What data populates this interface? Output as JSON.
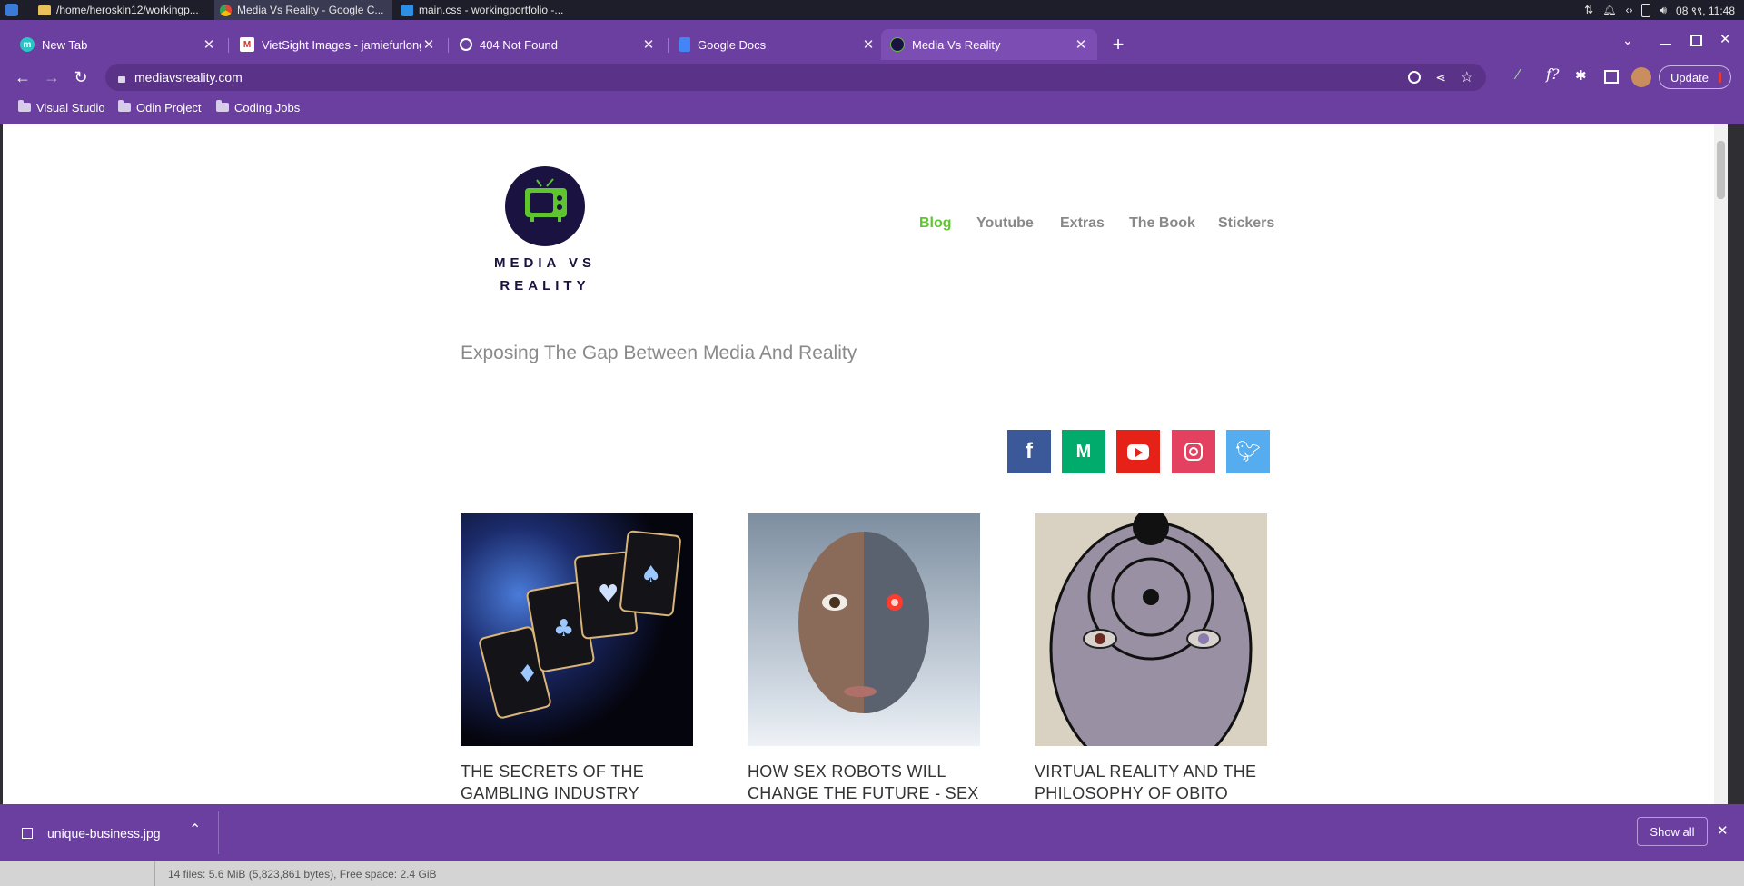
{
  "taskbar": {
    "apps": [
      {
        "label": "/home/heroskin12/workingp..."
      },
      {
        "label": "Media Vs Reality - Google C..."
      },
      {
        "label": "main.css - workingportfolio -..."
      }
    ],
    "clock": "08 ९९, 11:48"
  },
  "browser": {
    "tabs": [
      {
        "title": "New Tab",
        "favicon": "m"
      },
      {
        "title": "VietSight Images - jamiefurlong",
        "favicon": "M"
      },
      {
        "title": "404 Not Found",
        "favicon": "globe"
      },
      {
        "title": "Google Docs",
        "favicon": "docs"
      },
      {
        "title": "Media Vs Reality",
        "favicon": "tv"
      }
    ],
    "url": "mediavsreality.com",
    "update_label": "Update",
    "bookmarks": [
      {
        "label": "Visual Studio"
      },
      {
        "label": "Odin Project"
      },
      {
        "label": "Coding Jobs"
      }
    ]
  },
  "site": {
    "logo_line1": "MEDIA VS",
    "logo_line2": "REALITY",
    "nav": [
      {
        "label": "Blog",
        "active": true
      },
      {
        "label": "Youtube"
      },
      {
        "label": "Extras"
      },
      {
        "label": "The Book"
      },
      {
        "label": "Stickers"
      }
    ],
    "tagline": "Exposing The Gap Between Media And Reality",
    "social": [
      {
        "icon": "facebook-icon",
        "color": "#3b5998"
      },
      {
        "icon": "medium-icon",
        "color": "#00ab6c"
      },
      {
        "icon": "youtube-icon",
        "color": "#e62117"
      },
      {
        "icon": "instagram-icon",
        "color": "#e4405f"
      },
      {
        "icon": "twitter-icon",
        "color": "#55acee"
      }
    ],
    "posts": [
      {
        "title_line1": "THE SECRETS OF THE",
        "title_line2": "GAMBLING INDUSTRY"
      },
      {
        "title_line1": "HOW SEX ROBOTS WILL",
        "title_line2": "CHANGE THE FUTURE - SEX"
      },
      {
        "title_line1": "VIRTUAL REALITY AND THE",
        "title_line2": "PHILOSOPHY OF OBITO"
      }
    ]
  },
  "downloads": {
    "file": "unique-business.jpg",
    "show_all": "Show all"
  },
  "filemanager": {
    "status": "14 files: 5.6 MiB (5,823,861 bytes), Free space: 2.4 GiB"
  },
  "colors": {
    "chrome": "#6b3fa0",
    "nav_active": "#5fc52e",
    "logo": "#1a1240"
  }
}
